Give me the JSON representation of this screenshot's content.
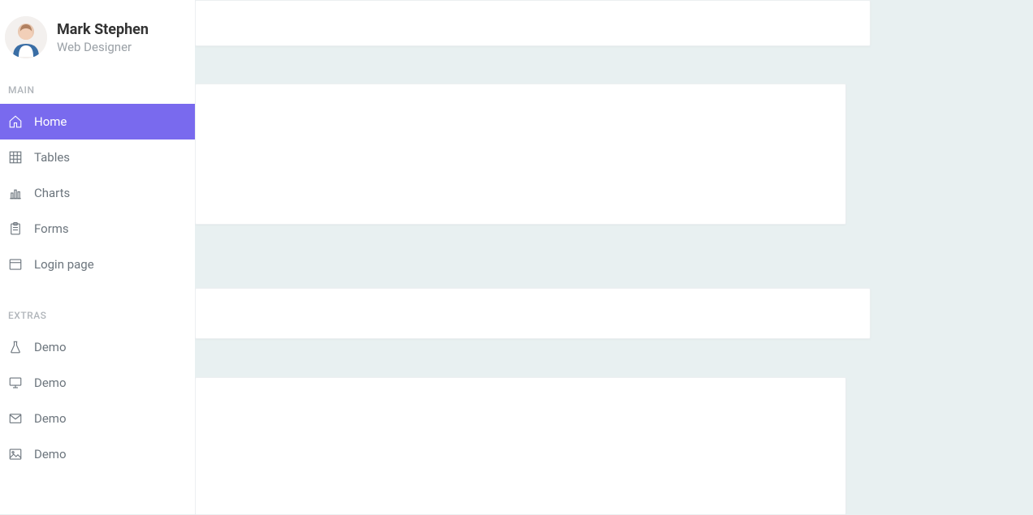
{
  "profile": {
    "name": "Mark Stephen",
    "role": "Web Designer"
  },
  "sections": {
    "main": "MAIN",
    "extras": "EXTRAS"
  },
  "nav": {
    "main": [
      {
        "label": "Home",
        "icon": "home-icon",
        "active": true
      },
      {
        "label": "Tables",
        "icon": "tables-grid-icon",
        "active": false
      },
      {
        "label": "Charts",
        "icon": "charts-icon",
        "active": false
      },
      {
        "label": "Forms",
        "icon": "clipboard-icon",
        "active": false
      },
      {
        "label": "Login page",
        "icon": "window-icon",
        "active": false
      }
    ],
    "extras": [
      {
        "label": "Demo",
        "icon": "flask-icon"
      },
      {
        "label": "Demo",
        "icon": "monitor-icon"
      },
      {
        "label": "Demo",
        "icon": "mail-icon"
      },
      {
        "label": "Demo",
        "icon": "image-icon"
      }
    ]
  },
  "colors": {
    "accent": "#796AEE",
    "background": "#e8f0f1"
  }
}
